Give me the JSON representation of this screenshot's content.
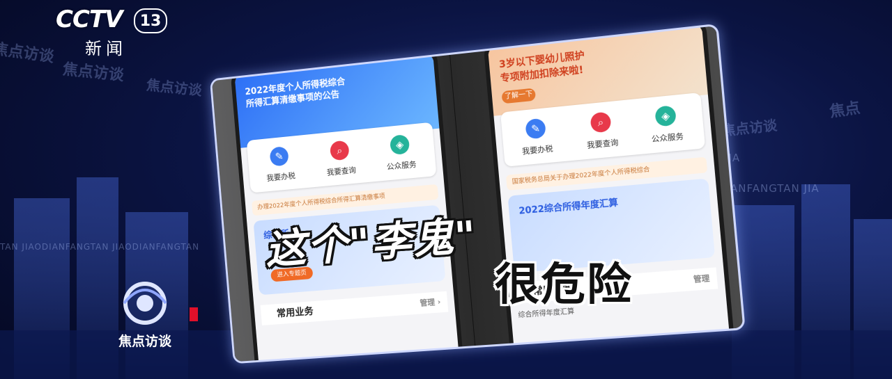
{
  "channel": {
    "logo": "CCTV",
    "number": "13",
    "subtitle": "新闻"
  },
  "program": {
    "name": "焦点访谈"
  },
  "background": {
    "watermarks": [
      "焦点访谈",
      "焦点访谈",
      "焦点访谈",
      "焦点",
      "焦点访谈"
    ],
    "roll_text_left": "TAN JIAODIANFANGTAN JIAODIANFANGTAN",
    "roll_text_right": "DIANFANGTAN JIA",
    "roll_text_right2": "JIA"
  },
  "left_phone": {
    "banner_title_1": "2022年度个人所得税综合",
    "banner_title_2": "所得汇算清缴事项的公告",
    "services": [
      "我要办税",
      "我要查询",
      "公众服务"
    ],
    "notice": "办理2022年度个人所得税综合所得汇算清缴事项",
    "promo_title": "综合所",
    "promo_button": "进入专题页",
    "list_title": "常用业务",
    "manage": "管理 ›"
  },
  "right_phone": {
    "banner_title_1": "3岁以下婴幼儿照护",
    "banner_title_2": "专项附加扣除来啦!",
    "banner_button": "了解一下",
    "services": [
      "我要办税",
      "我要查询",
      "公众服务"
    ],
    "notice": "国家税务总局关于办理2022年度个人所得税综合",
    "promo_title": "2022综合所得年度汇算",
    "list_title": "常用业务",
    "list_item": "综合所得年度汇算",
    "manage": "管理"
  },
  "captions": {
    "line1": "这个\"李鬼\"",
    "line2": "很危险"
  }
}
